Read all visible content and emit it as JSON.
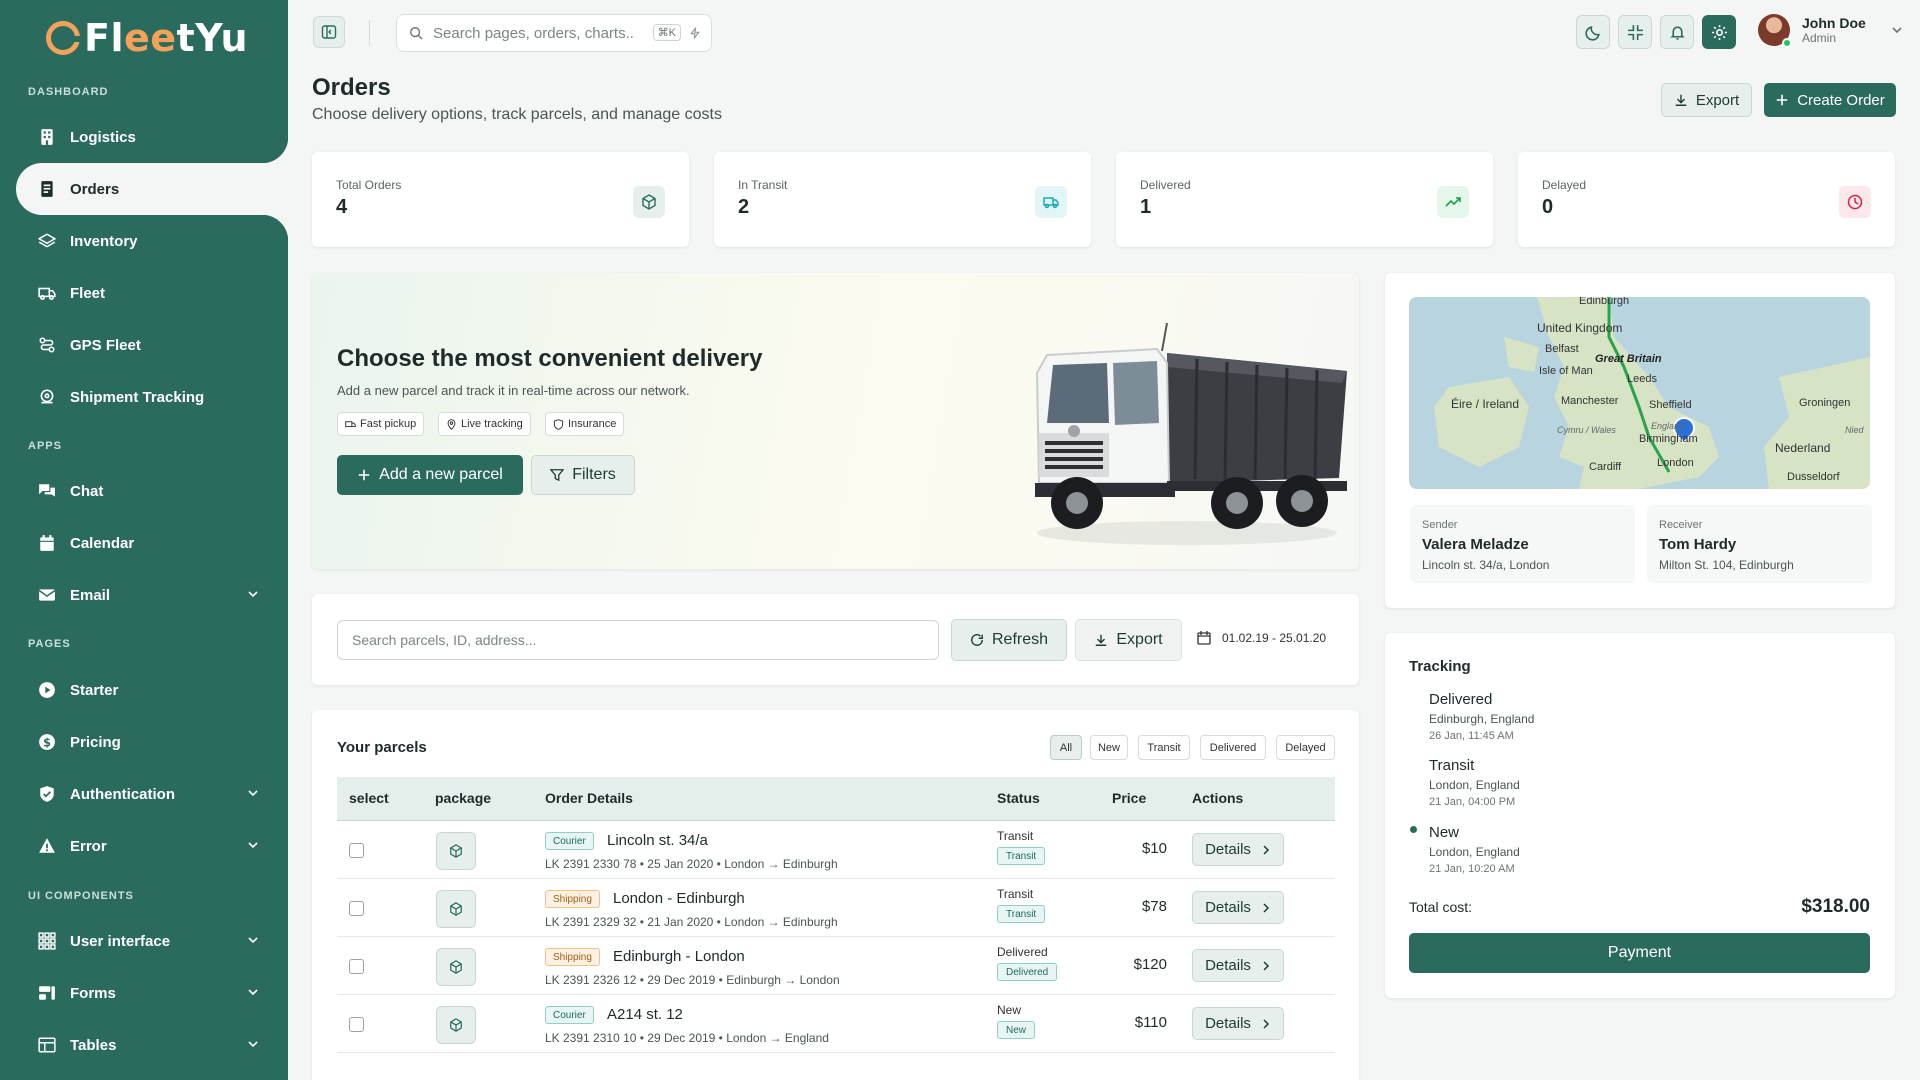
{
  "brand": {
    "logo_pre": "Fl",
    "logo_accent": "ee",
    "logo_post": "tYu",
    "accent_color": "#2a6b5e",
    "logo_color": "#f4a259"
  },
  "sidebar": {
    "sections": {
      "dashboard": "DASHBOARD",
      "apps": "APPS",
      "pages": "PAGES",
      "ui": "UI COMPONENTS"
    },
    "items": [
      {
        "label": "Logistics",
        "icon": "building-icon"
      },
      {
        "label": "Orders",
        "icon": "document-icon",
        "active": true
      },
      {
        "label": "Inventory",
        "icon": "layers-icon"
      },
      {
        "label": "Fleet",
        "icon": "truck-icon"
      },
      {
        "label": "GPS Fleet",
        "icon": "route-icon"
      },
      {
        "label": "Shipment Tracking",
        "icon": "tracking-icon"
      },
      {
        "label": "Chat",
        "icon": "chat-icon"
      },
      {
        "label": "Calendar",
        "icon": "calendar-icon"
      },
      {
        "label": "Email",
        "icon": "mail-icon",
        "expandable": true
      },
      {
        "label": "Starter",
        "icon": "play-icon"
      },
      {
        "label": "Pricing",
        "icon": "dollar-icon"
      },
      {
        "label": "Authentication",
        "icon": "shield-icon",
        "expandable": true
      },
      {
        "label": "Error",
        "icon": "warning-icon",
        "expandable": true
      },
      {
        "label": "User interface",
        "icon": "grid-icon",
        "expandable": true
      },
      {
        "label": "Forms",
        "icon": "forms-icon",
        "expandable": true
      },
      {
        "label": "Tables",
        "icon": "table-icon",
        "expandable": true
      }
    ]
  },
  "topbar": {
    "search_placeholder": "Search pages, orders, charts..",
    "shortcut": "⌘K",
    "user": {
      "name": "John Doe",
      "role": "Admin"
    }
  },
  "page": {
    "title": "Orders",
    "subtitle": "Choose delivery options, track parcels, and manage costs",
    "export_label": "Export",
    "create_label": "Create Order"
  },
  "stats": [
    {
      "label": "Total Orders",
      "value": "4",
      "icon": "package-icon",
      "color": "#2a6b5e"
    },
    {
      "label": "In Transit",
      "value": "2",
      "icon": "truck-icon",
      "color": "#0ea5b7"
    },
    {
      "label": "Delivered",
      "value": "1",
      "icon": "trend-up-icon",
      "color": "#16a34a"
    },
    {
      "label": "Delayed",
      "value": "0",
      "icon": "clock-icon",
      "color": "#e11d48"
    }
  ],
  "hero": {
    "title": "Choose the most convenient delivery",
    "subtitle": "Add a new parcel and track it in real-time across our network.",
    "chips": [
      "Fast pickup",
      "Live tracking",
      "Insurance"
    ],
    "add_label": "Add a new parcel",
    "filters_label": "Filters"
  },
  "map": {
    "labels": [
      "United Kingdom",
      "Belfast",
      "Great Britain",
      "Isle of Man",
      "Leeds",
      "Éire / Ireland",
      "Manchester",
      "Sheffield",
      "Groningen",
      "Cymru / Wales",
      "Birmingham",
      "England",
      "Nederland",
      "Cardiff",
      "London",
      "Dusseldorf",
      "Edinburgh",
      "Nied"
    ]
  },
  "parties": {
    "sender": {
      "label": "Sender",
      "name": "Valera Meladze",
      "address": "Lincoln st. 34/a, London"
    },
    "receiver": {
      "label": "Receiver",
      "name": "Tom Hardy",
      "address": "Milton St. 104, Edinburgh"
    }
  },
  "filterbar": {
    "placeholder": "Search parcels, ID, address...",
    "refresh_label": "Refresh",
    "export_label": "Export",
    "date_range": "01.02.19 - 25.01.20"
  },
  "parcels": {
    "title": "Your parcels",
    "tabs": [
      "All",
      "New",
      "Transit",
      "Delivered",
      "Delayed"
    ],
    "columns": {
      "select": "select",
      "package": "package",
      "details": "Order Details",
      "status": "Status",
      "price": "Price",
      "actions": "Actions"
    },
    "details_label": "Details",
    "rows": [
      {
        "type": "Courier",
        "name": "Lincoln st. 34/a",
        "meta": "LK 2391 2330 78 • 25 Jan 2020 • London → Edinburgh",
        "status": "Transit",
        "badge": "Transit",
        "price": "$10"
      },
      {
        "type": "Shipping",
        "name": "London - Edinburgh",
        "meta": "LK 2391 2329 32 • 21 Jan 2020 • London → Edinburgh",
        "status": "Transit",
        "badge": "Transit",
        "price": "$78"
      },
      {
        "type": "Shipping",
        "name": "Edinburgh - London",
        "meta": "LK 2391 2326 12 • 29 Dec 2019 • Edinburgh → London",
        "status": "Delivered",
        "badge": "Delivered",
        "price": "$120"
      },
      {
        "type": "Courier",
        "name": "A214 st. 12",
        "meta": "LK 2391 2310 10 • 29 Dec 2019 • London → England",
        "status": "New",
        "badge": "New",
        "price": "$110"
      }
    ]
  },
  "tracking": {
    "title": "Tracking",
    "steps": [
      {
        "status": "Delivered",
        "place": "Edinburgh, England",
        "time": "26 Jan, 11:45 AM"
      },
      {
        "status": "Transit",
        "place": "London, England",
        "time": "21 Jan, 04:00 PM"
      },
      {
        "status": "New",
        "place": "London, England",
        "time": "21 Jan, 10:20 AM"
      }
    ],
    "total_label": "Total cost:",
    "total_value": "$318.00",
    "payment_label": "Payment"
  }
}
